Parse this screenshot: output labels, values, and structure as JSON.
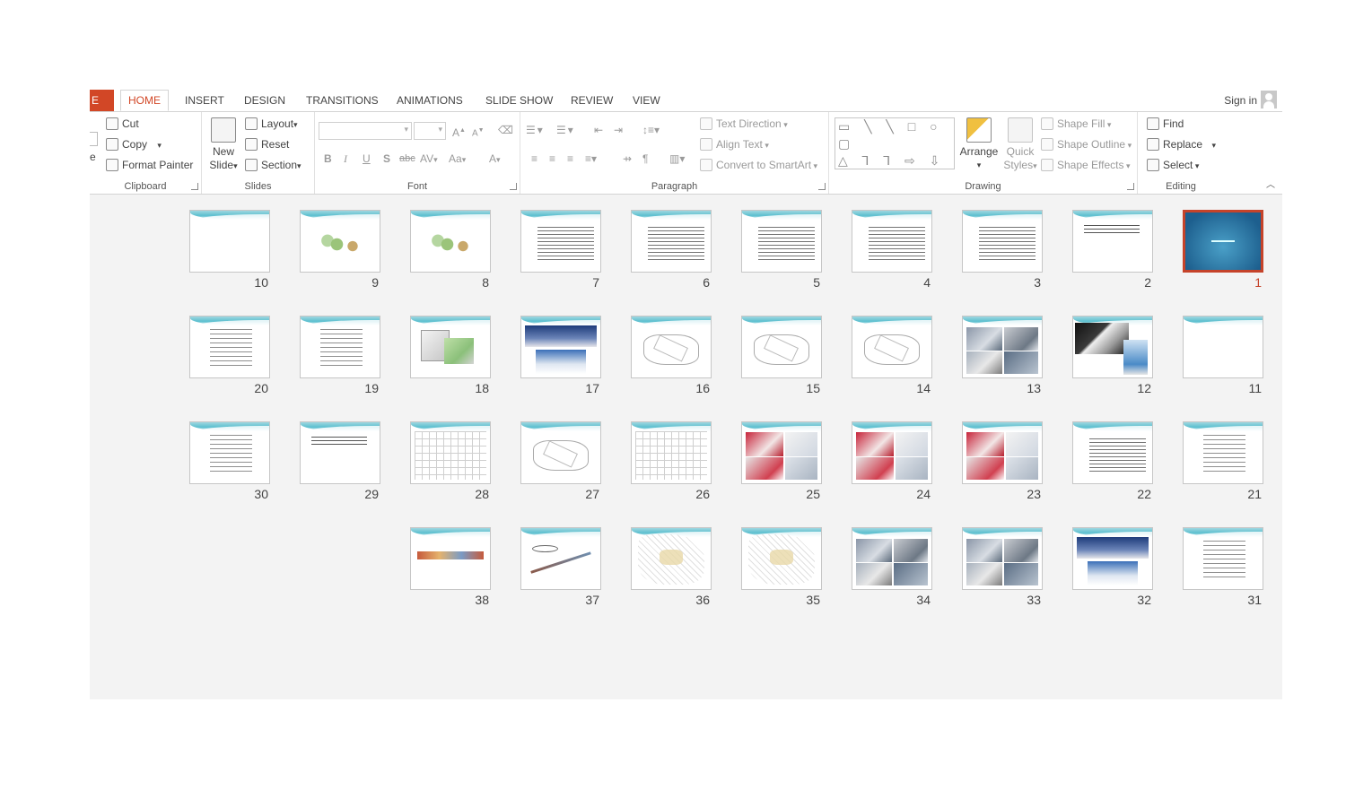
{
  "tabs": {
    "file": "E",
    "home": "HOME",
    "insert": "INSERT",
    "design": "DESIGN",
    "transitions": "TRANSITIONS",
    "animations": "ANIMATIONS",
    "slideshow": "SLIDE SHOW",
    "review": "REVIEW",
    "view": "VIEW",
    "active": "HOME"
  },
  "account": {
    "signin": "Sign in"
  },
  "ribbon": {
    "clipboard": {
      "label": "Clipboard",
      "paste_partial": "e",
      "cut": "Cut",
      "copy": "Copy",
      "format_painter": "Format Painter"
    },
    "slides": {
      "label": "Slides",
      "new_slide_1": "New",
      "new_slide_2": "Slide",
      "layout": "Layout",
      "reset": "Reset",
      "section": "Section"
    },
    "font": {
      "label": "Font",
      "bold": "B",
      "italic": "I",
      "underline": "U",
      "shadow": "S",
      "strike": "abc",
      "spacing": "AV",
      "case": "Aa",
      "color": "A",
      "grow": "A",
      "shrink": "A"
    },
    "paragraph": {
      "label": "Paragraph",
      "text_direction": "Text Direction",
      "align_text": "Align Text",
      "convert_smartart": "Convert to SmartArt"
    },
    "drawing": {
      "label": "Drawing",
      "shapes_row1": "▭ ╲ ╲ □ ○ ▢",
      "shapes_row2": "△ ⅂ ⅂ ⇨ ⇩ ⬡",
      "shapes_row3": "⌇ ⌒ ∩ { } ☆",
      "arrange": "Arrange",
      "quick_styles_1": "Quick",
      "quick_styles_2": "Styles",
      "shape_fill": "Shape Fill",
      "shape_outline": "Shape Outline",
      "shape_effects": "Shape Effects"
    },
    "editing": {
      "label": "Editing",
      "find": "Find",
      "replace": "Replace",
      "select": "Select"
    }
  },
  "slides": {
    "selected": "1",
    "items": [
      {
        "n": "10",
        "thumb": "elevation"
      },
      {
        "n": "9",
        "thumb": "site"
      },
      {
        "n": "8",
        "thumb": "site"
      },
      {
        "n": "7",
        "thumb": "text"
      },
      {
        "n": "6",
        "thumb": "text"
      },
      {
        "n": "5",
        "thumb": "text"
      },
      {
        "n": "4",
        "thumb": "text"
      },
      {
        "n": "3",
        "thumb": "text"
      },
      {
        "n": "2",
        "thumb": "title"
      },
      {
        "n": "1",
        "thumb": "blue"
      },
      {
        "n": "20",
        "thumb": "textl"
      },
      {
        "n": "19",
        "thumb": "textl"
      },
      {
        "n": "18",
        "thumb": "3d"
      },
      {
        "n": "17",
        "thumb": "bld"
      },
      {
        "n": "16",
        "thumb": "draw"
      },
      {
        "n": "15",
        "thumb": "draw"
      },
      {
        "n": "14",
        "thumb": "draw"
      },
      {
        "n": "13",
        "thumb": "photo"
      },
      {
        "n": "12",
        "thumb": "bk"
      },
      {
        "n": "11",
        "thumb": "elevation"
      },
      {
        "n": "30",
        "thumb": "textl"
      },
      {
        "n": "29",
        "thumb": "title"
      },
      {
        "n": "28",
        "thumb": "grid"
      },
      {
        "n": "27",
        "thumb": "draw"
      },
      {
        "n": "26",
        "thumb": "grid"
      },
      {
        "n": "25",
        "thumb": "red"
      },
      {
        "n": "24",
        "thumb": "red"
      },
      {
        "n": "23",
        "thumb": "red"
      },
      {
        "n": "22",
        "thumb": "text"
      },
      {
        "n": "21",
        "thumb": "textl"
      },
      {
        "n": "38",
        "thumb": "strip"
      },
      {
        "n": "37",
        "thumb": "line"
      },
      {
        "n": "36",
        "thumb": "iso"
      },
      {
        "n": "35",
        "thumb": "iso"
      },
      {
        "n": "34",
        "thumb": "photo"
      },
      {
        "n": "33",
        "thumb": "photo"
      },
      {
        "n": "32",
        "thumb": "bld"
      },
      {
        "n": "31",
        "thumb": "textl"
      }
    ]
  },
  "colors": {
    "accent": "#d24726",
    "selected_border": "#c5432a",
    "workspace": "#f3f3f3"
  }
}
